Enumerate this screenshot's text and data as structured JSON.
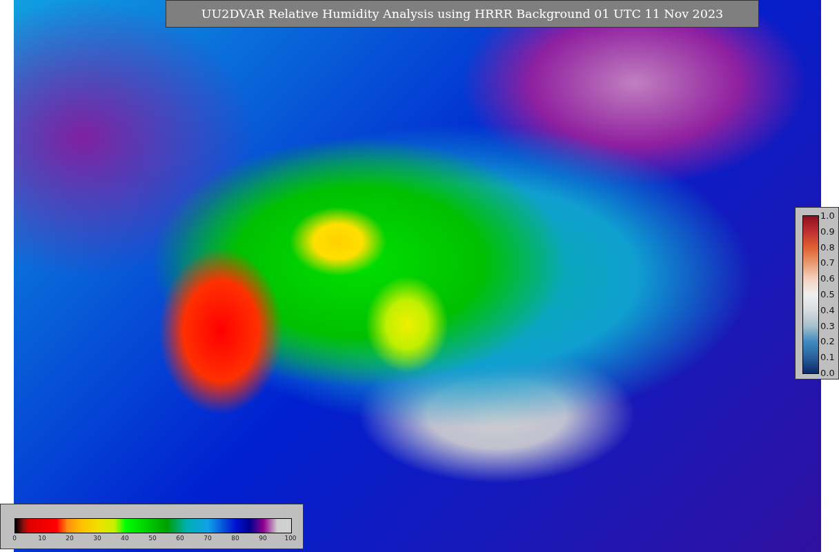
{
  "title": "UU2DVAR Relative Humidity Analysis using HRRR Background 01 UTC 11 Nov 2023",
  "humidity_legend": {
    "ticks": [
      "0",
      "10",
      "20",
      "30",
      "40",
      "50",
      "60",
      "70",
      "80",
      "90",
      "100"
    ]
  },
  "ratio_legend": {
    "ticks": [
      "1.0",
      "0.9",
      "0.8",
      "0.7",
      "0.6",
      "0.5",
      "0.4",
      "0.3",
      "0.2",
      "0.1",
      "0.0"
    ]
  }
}
